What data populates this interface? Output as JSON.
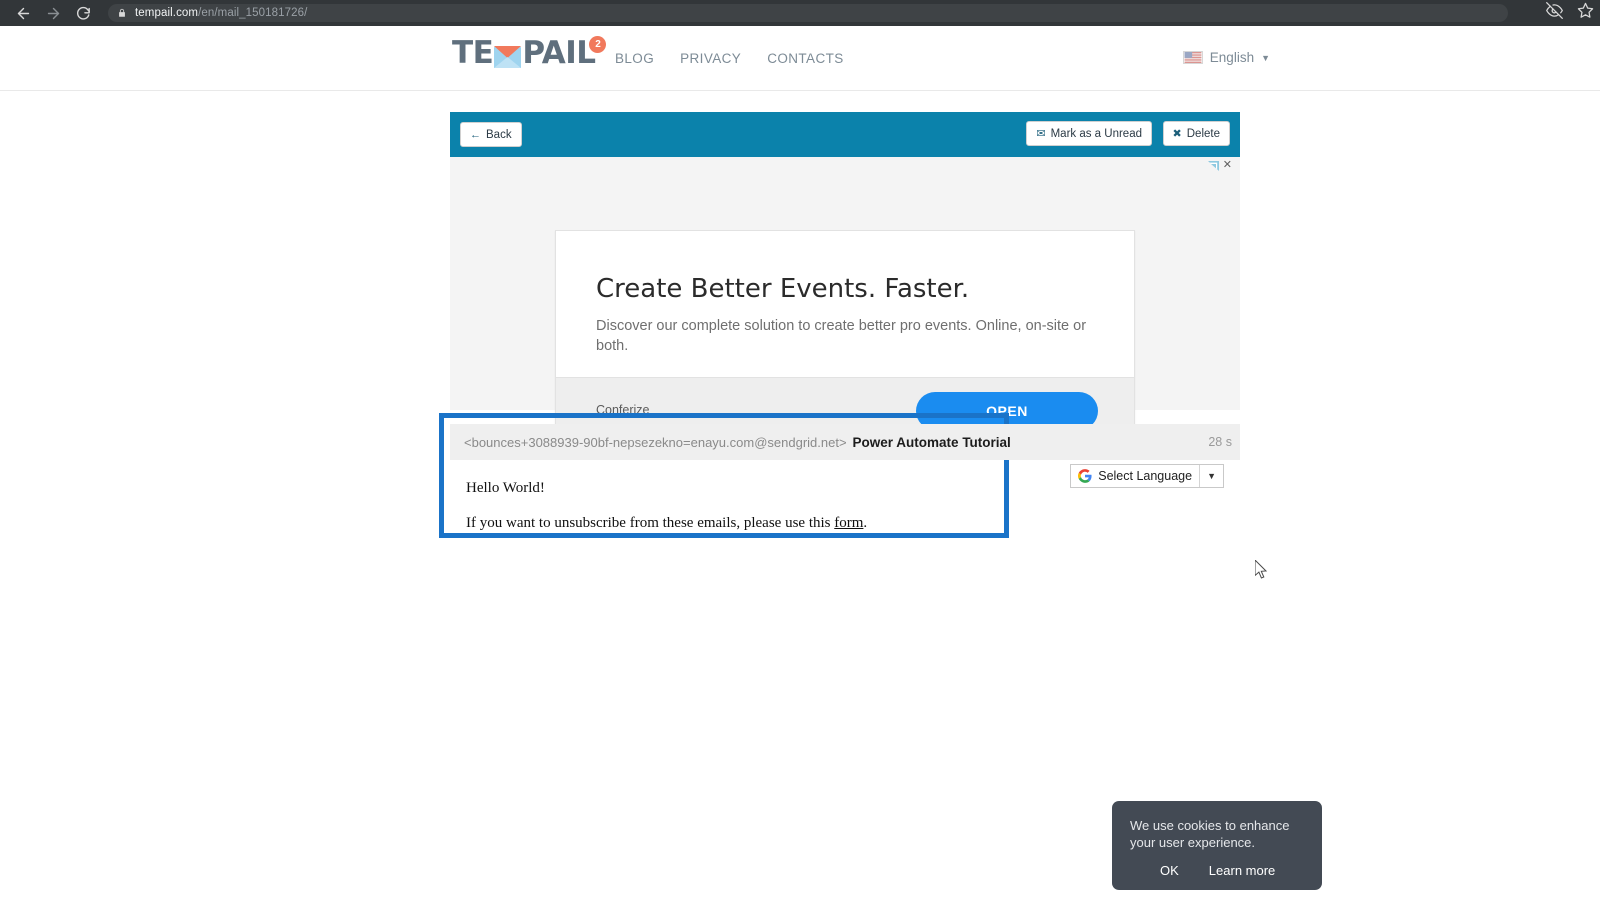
{
  "browser": {
    "url_domain": "tempail.com",
    "url_path": "/en/mail_150181726/",
    "icons": {
      "back": "back-arrow-icon",
      "forward": "forward-arrow-icon",
      "reload": "reload-icon",
      "lock": "lock-icon",
      "eye_off": "eye-off-icon",
      "star": "star-icon"
    }
  },
  "site_header": {
    "logo_part1": "TE",
    "logo_part2": "PAIL",
    "logo_badge": "2",
    "nav": [
      {
        "label": "BLOG"
      },
      {
        "label": "PRIVACY"
      },
      {
        "label": "CONTACTS"
      }
    ],
    "language": {
      "label": "English",
      "caret": "▼"
    }
  },
  "toolbar": {
    "back_label": "Back",
    "back_icon": "←",
    "mark_unread_label": "Mark as a Unread",
    "mark_unread_icon": "✉",
    "delete_label": "Delete",
    "delete_icon": "✖",
    "bg_color": "#0b82ab"
  },
  "ad": {
    "close_label": "✕",
    "headline": "Create Better Events. Faster.",
    "body": "Discover our complete solution to create better pro events. Online, on-site or both.",
    "brand": "Conferize",
    "cta_label": "OPEN",
    "cta_color": "#1a8cf0"
  },
  "mail": {
    "from": "<bounces+3088939-90bf-nepsezekno=enayu.com@sendgrid.net>",
    "subject": "Power Automate Tutorial",
    "time": "28 s",
    "body_line1": "Hello World!",
    "body_line2_prefix": "If you want to unsubscribe from these emails, please use this ",
    "body_link": "form",
    "body_line2_suffix": ".",
    "highlight_color": "#1a73c8"
  },
  "translate": {
    "label": "Select Language",
    "caret": "▼"
  },
  "cookie": {
    "text": "We use cookies to enhance your user experience.",
    "ok_label": "OK",
    "learn_label": "Learn more"
  }
}
